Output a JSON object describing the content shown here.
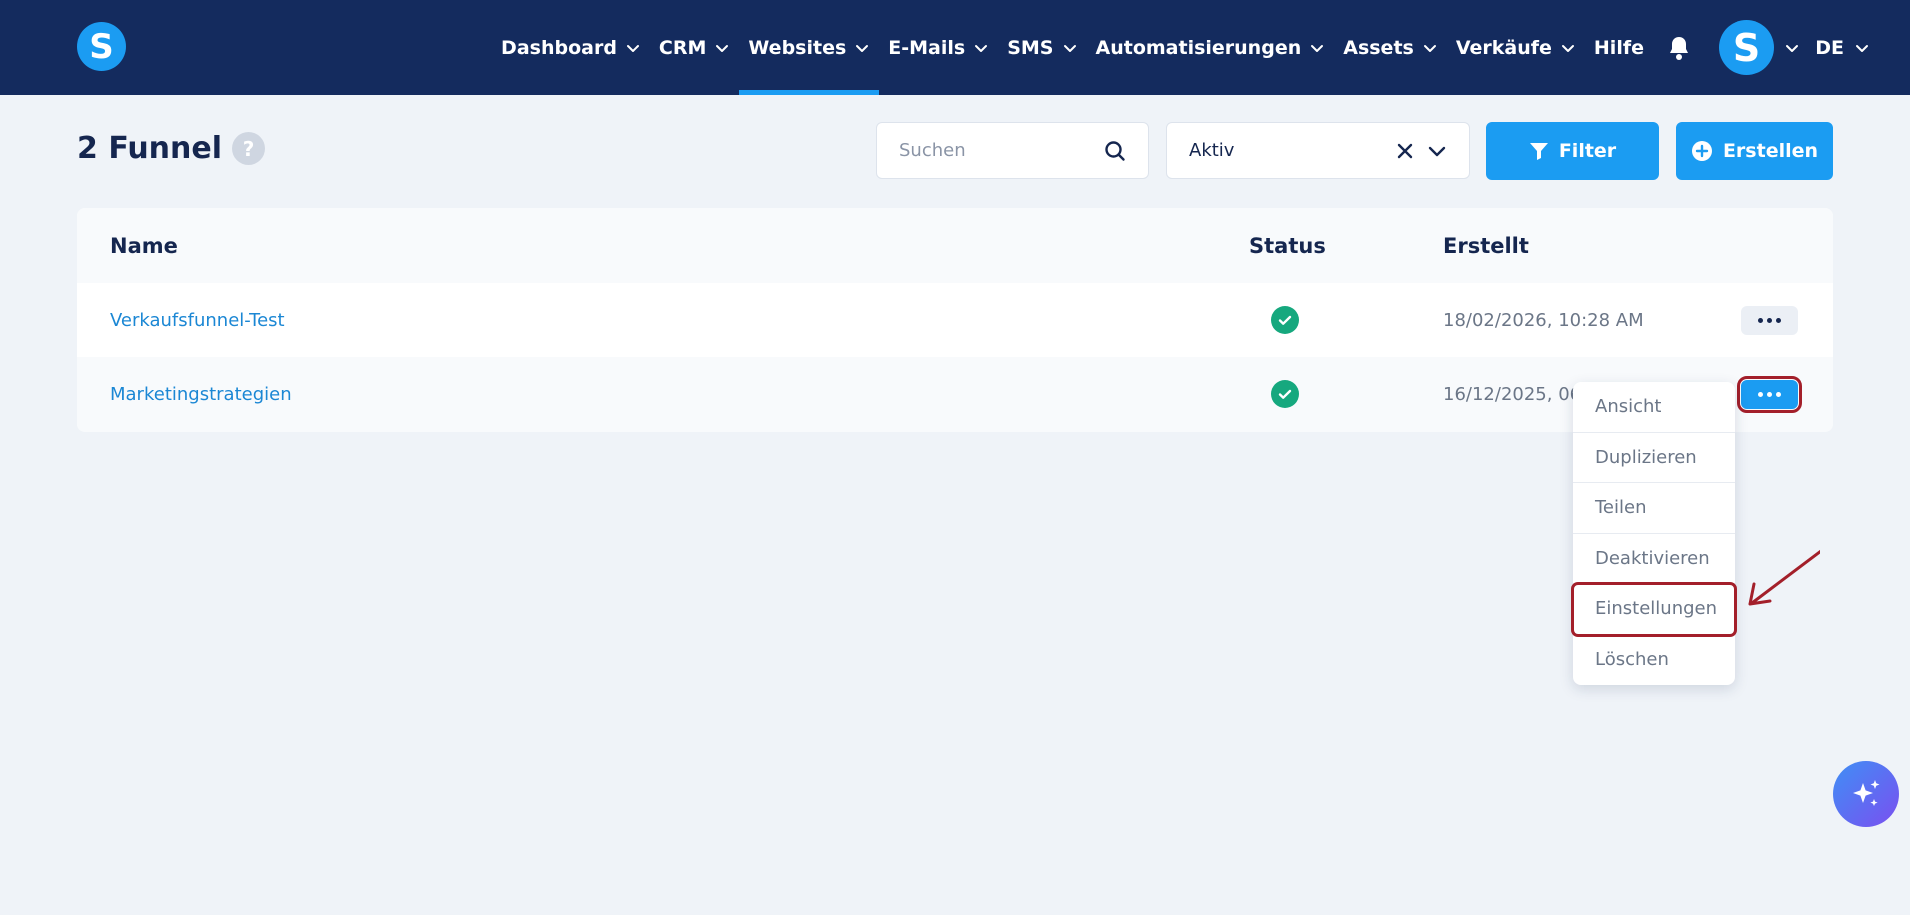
{
  "brand": {
    "logo_letter": "S"
  },
  "nav": {
    "items": [
      {
        "label": "Dashboard",
        "has_menu": true,
        "active": false
      },
      {
        "label": "CRM",
        "has_menu": true,
        "active": false
      },
      {
        "label": "Websites",
        "has_menu": true,
        "active": true
      },
      {
        "label": "E-Mails",
        "has_menu": true,
        "active": false
      },
      {
        "label": "SMS",
        "has_menu": true,
        "active": false
      },
      {
        "label": "Automatisierungen",
        "has_menu": true,
        "active": false
      },
      {
        "label": "Assets",
        "has_menu": true,
        "active": false
      },
      {
        "label": "Verkäufe",
        "has_menu": true,
        "active": false
      },
      {
        "label": "Hilfe",
        "has_menu": false,
        "active": false
      }
    ],
    "avatar_letter": "S",
    "language": "DE"
  },
  "header": {
    "title": "2 Funnel",
    "help": "?",
    "search_placeholder": "Suchen",
    "status_filter_value": "Aktiv",
    "filter_label": "Filter",
    "create_label": "Erstellen"
  },
  "table": {
    "columns": {
      "name": "Name",
      "status": "Status",
      "created": "Erstellt"
    },
    "rows": [
      {
        "name": "Verkaufsfunnel-Test",
        "status": "active",
        "created": "18/02/2026, 10:28 AM"
      },
      {
        "name": "Marketingstrategien",
        "status": "active",
        "created": "16/12/2025, 06:"
      }
    ]
  },
  "row_menu": {
    "items": [
      "Ansicht",
      "Duplizieren",
      "Teilen",
      "Deaktivieren",
      "Einstellungen",
      "Löschen"
    ],
    "highlighted": "Einstellungen"
  },
  "colors": {
    "nav_bg": "#142b5e",
    "accent": "#1b9cf2",
    "status_ok": "#16a87e",
    "annotation": "#a31f2a"
  }
}
